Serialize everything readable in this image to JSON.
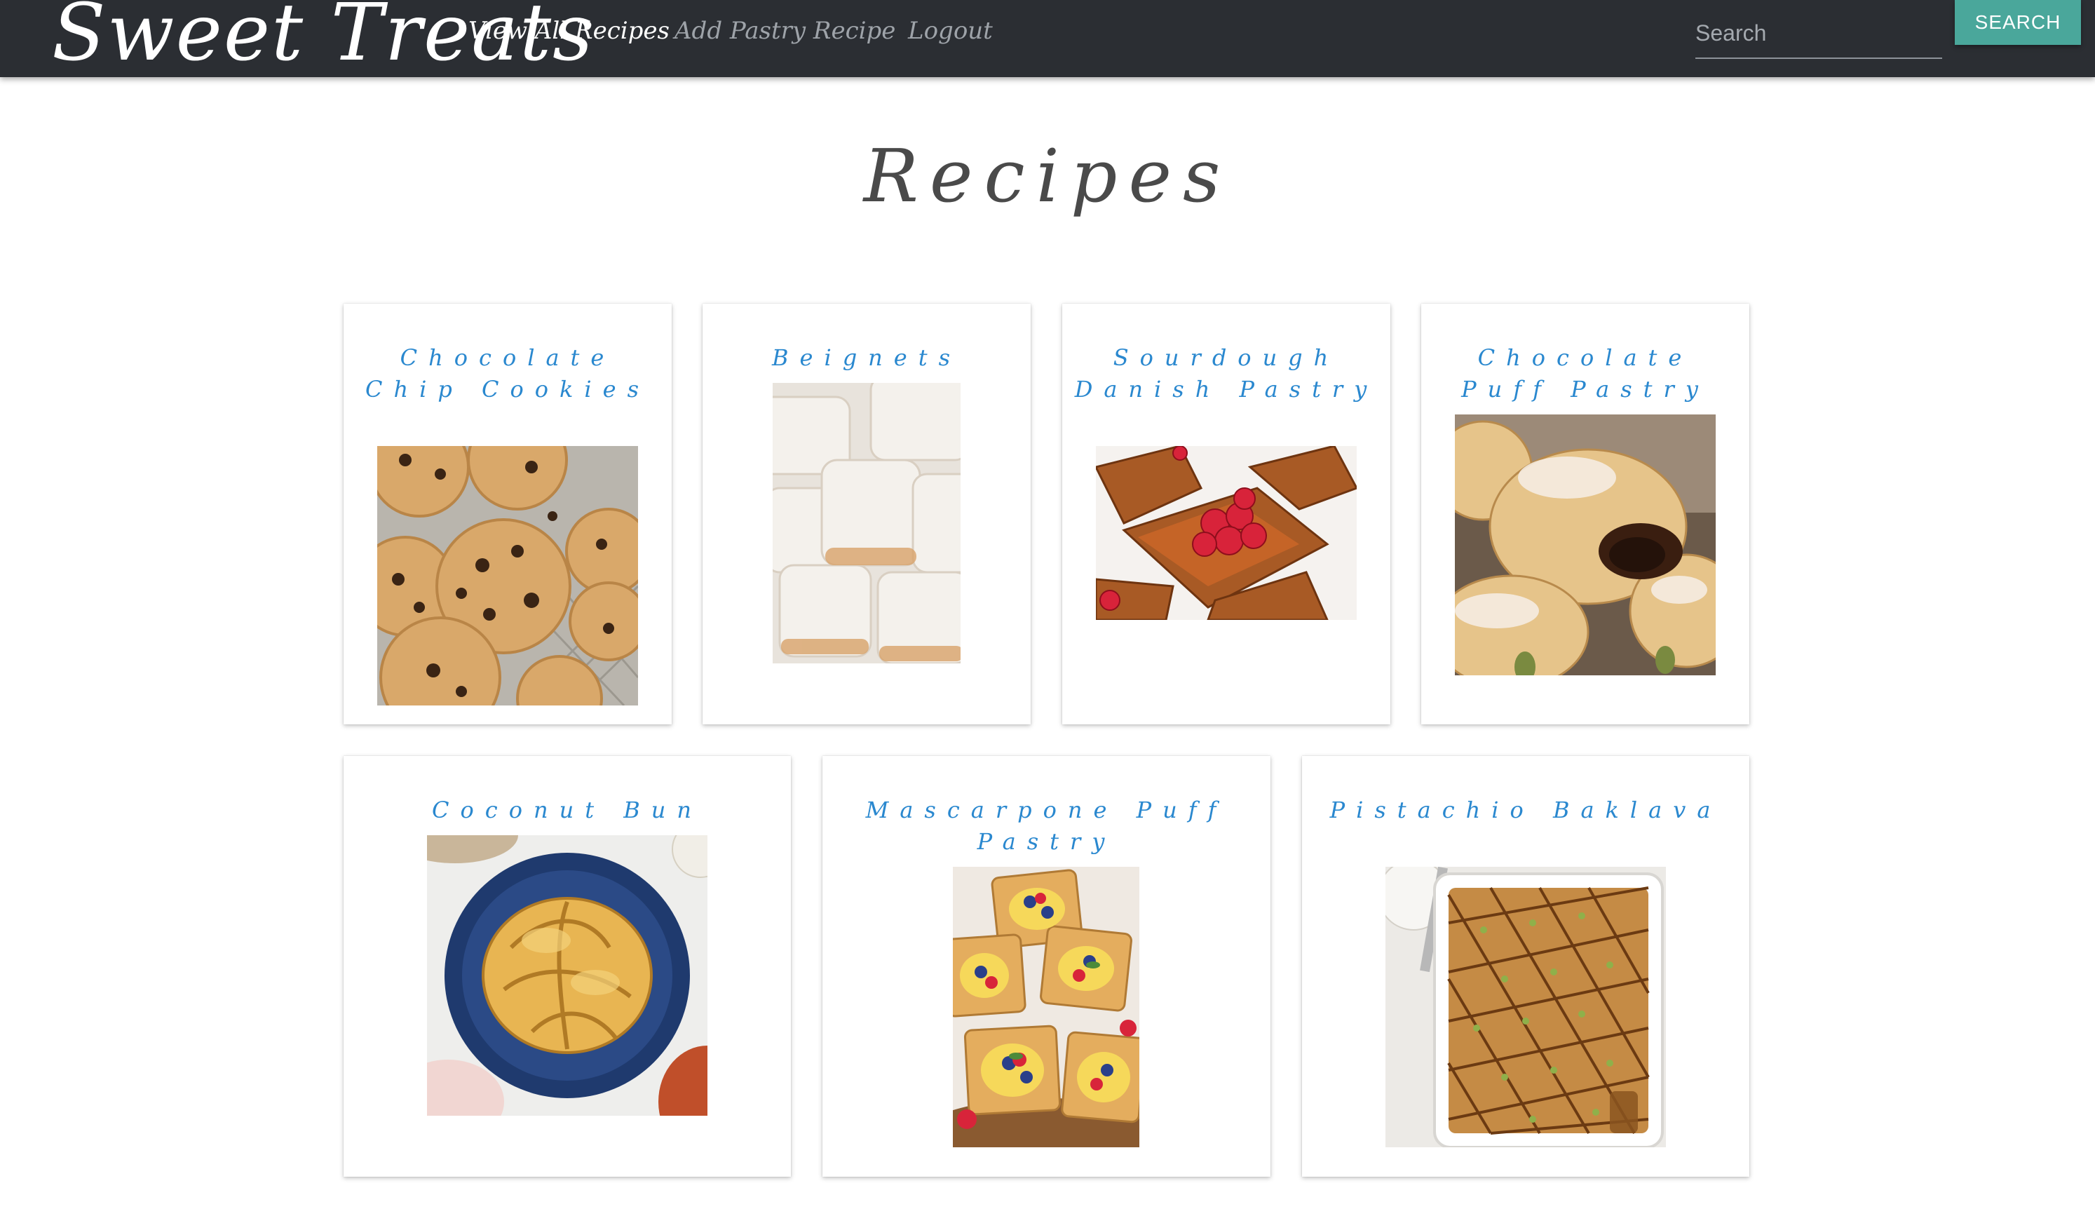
{
  "navbar": {
    "brand": "Sweet Treats",
    "links": [
      {
        "label": "View All Recipes"
      },
      {
        "label": "Add Pastry Recipe"
      },
      {
        "label": "Logout"
      }
    ],
    "search_placeholder": "Search",
    "search_button": "SEARCH"
  },
  "page": {
    "title": "Recipes"
  },
  "recipes": [
    {
      "title": "Chocolate Chip Cookies",
      "image": "chocolate-chip-cookies-photo"
    },
    {
      "title": "Beignets",
      "image": "beignets-photo"
    },
    {
      "title": "Sourdough Danish Pastry",
      "image": "sourdough-danish-pastry-photo"
    },
    {
      "title": "Chocolate Puff Pastry",
      "image": "chocolate-puff-pastry-photo"
    },
    {
      "title": "Coconut Bun",
      "image": "coconut-bun-photo"
    },
    {
      "title": "Mascarpone Puff Pastry",
      "image": "mascarpone-puff-pastry-photo"
    },
    {
      "title": "Pistachio Baklava",
      "image": "pistachio-baklava-photo"
    }
  ],
  "colors": {
    "navbar_bg": "#2b2e33",
    "accent_button": "#4aa79b",
    "card_title": "#2a88cf",
    "heading": "#4a4a4a"
  }
}
